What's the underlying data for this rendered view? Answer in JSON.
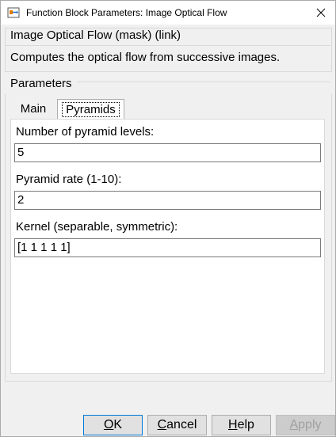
{
  "window": {
    "title": "Function Block Parameters: Image Optical Flow"
  },
  "mask": {
    "title": "Image Optical Flow (mask) (link)",
    "description": "Computes the optical flow from successive images."
  },
  "parameters": {
    "label": "Parameters",
    "tabs": [
      {
        "label": "Main",
        "active": false
      },
      {
        "label": "Pyramids",
        "active": true
      }
    ],
    "fields": [
      {
        "label": "Number of pyramid levels:",
        "value": "5"
      },
      {
        "label": "Pyramid rate (1-10):",
        "value": "2"
      },
      {
        "label": "Kernel (separable, symmetric):",
        "value": "[1 1 1 1 1]"
      }
    ]
  },
  "buttons": {
    "ok": {
      "first": "O",
      "rest": "K"
    },
    "cancel": {
      "first": "C",
      "rest": "ancel"
    },
    "help": {
      "first": "H",
      "rest": "elp"
    },
    "apply": {
      "first": "A",
      "rest": "pply",
      "enabled": false
    }
  },
  "colors": {
    "dialog_bg": "#f0f0f0",
    "panel_bg": "#ffffff",
    "focus_border": "#0078d7",
    "disabled_text": "#a0a0a0"
  }
}
